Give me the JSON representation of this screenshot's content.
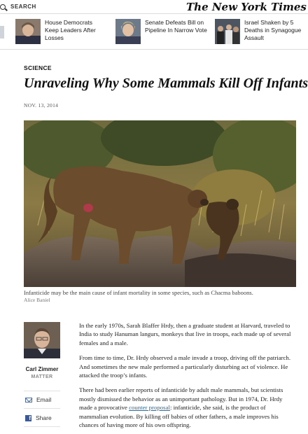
{
  "topbar": {
    "search_label": "SEARCH",
    "masthead": "The New York Times"
  },
  "headlines_strip": [
    {
      "text": "House Democrats Keep Leaders After Losses",
      "thumb": "portrait-woman-icon"
    },
    {
      "text": "Senate Defeats Bill on Pipeline In Narrow Vote",
      "thumb": "portrait-woman-icon"
    },
    {
      "text": "Israel Shaken by 5 Deaths in Synagogue Assault",
      "thumb": "crowd-scene-icon"
    }
  ],
  "article": {
    "section": "SCIENCE",
    "headline": "Unraveling Why Some Mammals Kill Off Infants",
    "date": "NOV. 13, 2014",
    "photo_caption": "Infanticide may be the main cause of infant mortality in some species, such as Chacma baboons.",
    "photo_credit": "Alice Baniel",
    "paragraphs": [
      "In the early 1970s, Sarah Blaffer Hrdy, then a graduate student at Harvard, traveled to India to study Hanuman langurs, monkeys that live in troops, each made up of several females and a male.",
      "From time to time, Dr. Hrdy observed a male invade a troop, driving off the patriarch. And sometimes the new male performed a particularly disturbing act of violence. He attacked the troop’s infants."
    ],
    "para3": {
      "before_link": "There had been earlier reports of infanticide by adult male mammals, but scientists mostly dismissed the behavior as an unimportant pathology. But in 1974, Dr. Hrdy made a provocative ",
      "link": "counter proposal",
      "after_link": ": infanticide, she said, is the product of mammalian evolution. By killing off babies of other fathers, a male improves his chances of having more of his own offspring."
    }
  },
  "byline": {
    "name": "Carl Zimmer",
    "role": "MATTER"
  },
  "share": {
    "email_label": "Email",
    "facebook_label": "Share"
  },
  "colors": {
    "link": "#326891",
    "facebook": "#3b5998"
  }
}
